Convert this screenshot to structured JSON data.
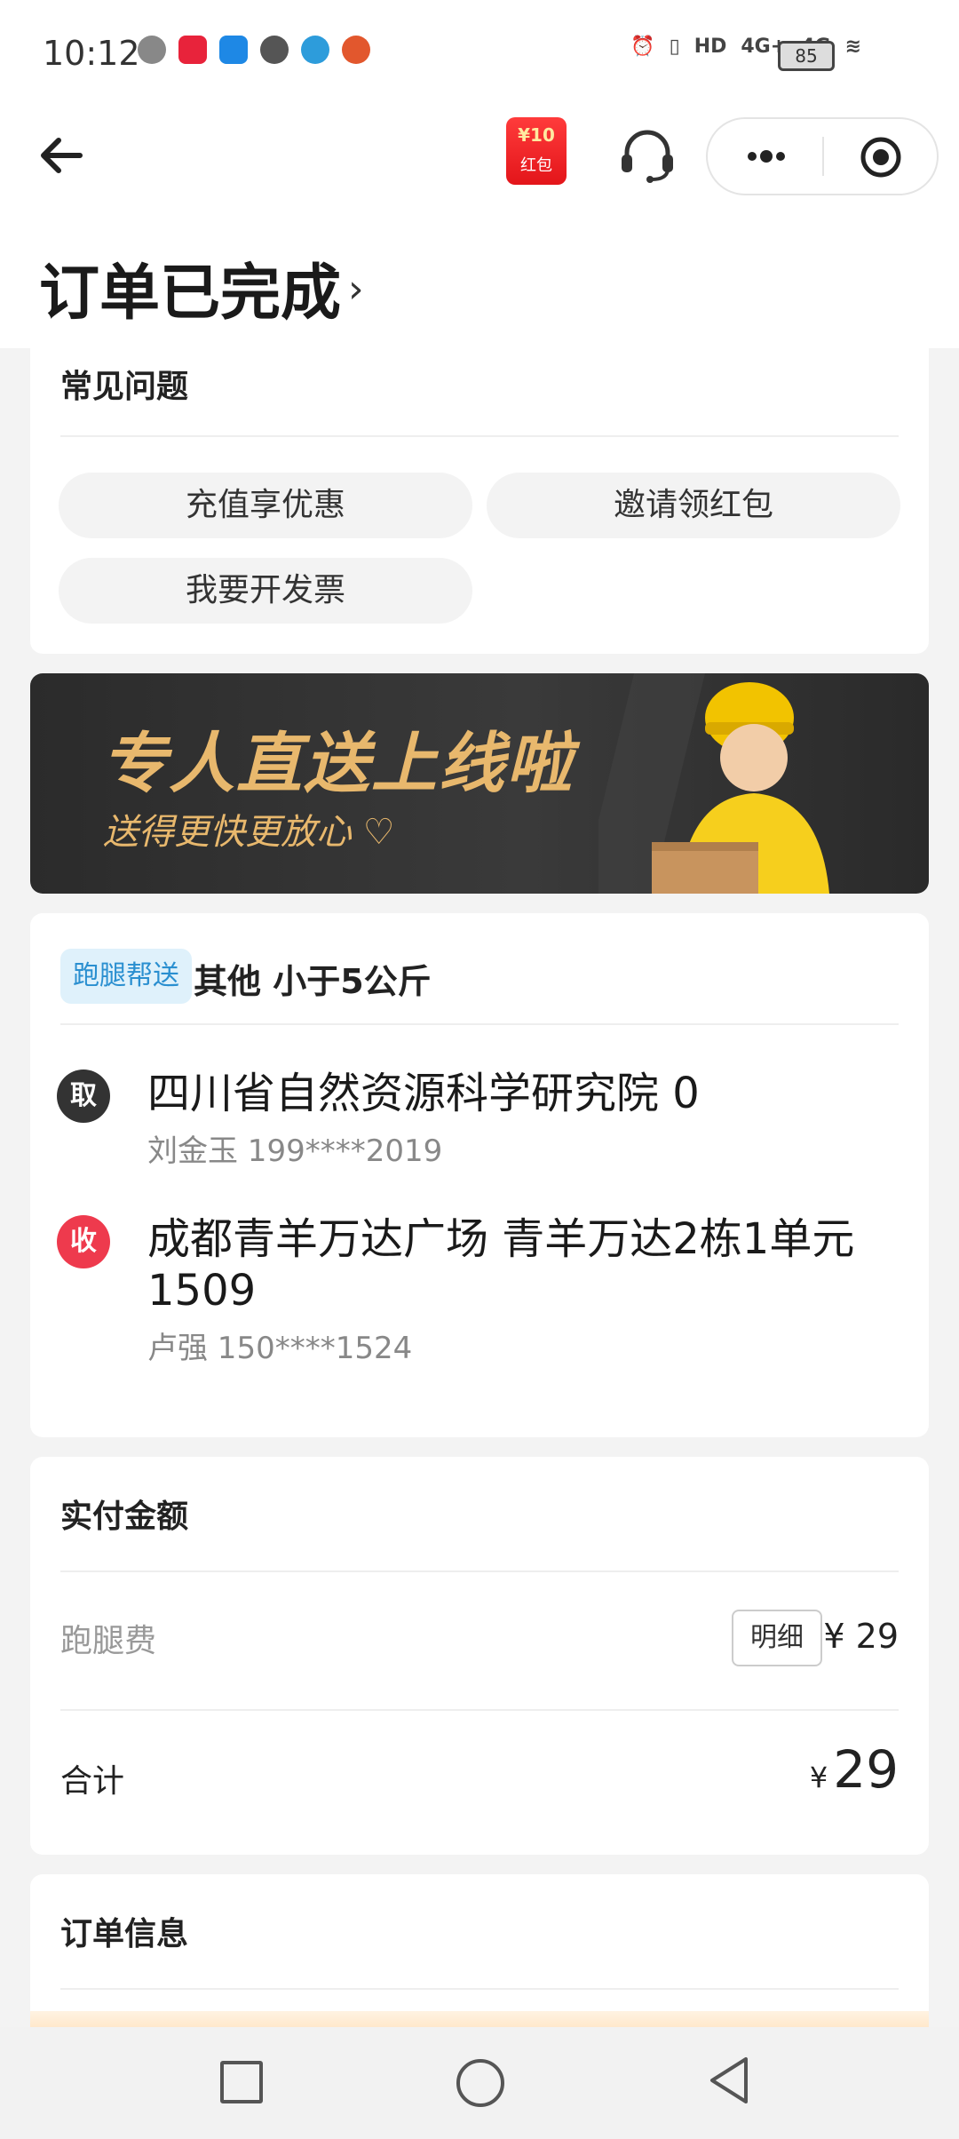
{
  "status_bar": {
    "time": "10:12",
    "signal1": "4G+",
    "signal2": "4G",
    "battery": "85",
    "hd_label": "HD"
  },
  "nav": {
    "hongbao_amount": "¥10",
    "hongbao_label": "红包"
  },
  "header": {
    "title": "订单已完成",
    "chevron": "›"
  },
  "faq": {
    "title": "常见问题",
    "buttons": [
      "充值享优惠",
      "邀请领红包",
      "我要开发票"
    ]
  },
  "banner": {
    "title": "专人直送上线啦",
    "subtitle": "送得更快更放心 ♡"
  },
  "order": {
    "tag": "跑腿帮送",
    "category": "其他  小于5公斤",
    "pickup": {
      "badge": "取",
      "address": "四川省自然资源科学研究院 0",
      "contact": "刘金玉   199****2019"
    },
    "dropoff": {
      "badge": "收",
      "address": "成都青羊万达广场 青羊万达2栋1单元1509",
      "contact": "卢强   150****1524"
    }
  },
  "payment": {
    "title": "实付金额",
    "fee_label": "跑腿费",
    "detail_button": "明细",
    "fee_amount": "¥ 29",
    "total_label": "合计",
    "total_yen": "¥",
    "total_amount": "29"
  },
  "order_info": {
    "title": "订单信息"
  },
  "colors": {
    "pickup_badge": "#333333",
    "dropoff_badge": "#ee3a4d",
    "banner_text": "#e8b86d",
    "tag_bg": "#dff1fb",
    "tag_text": "#2a8fd0"
  }
}
